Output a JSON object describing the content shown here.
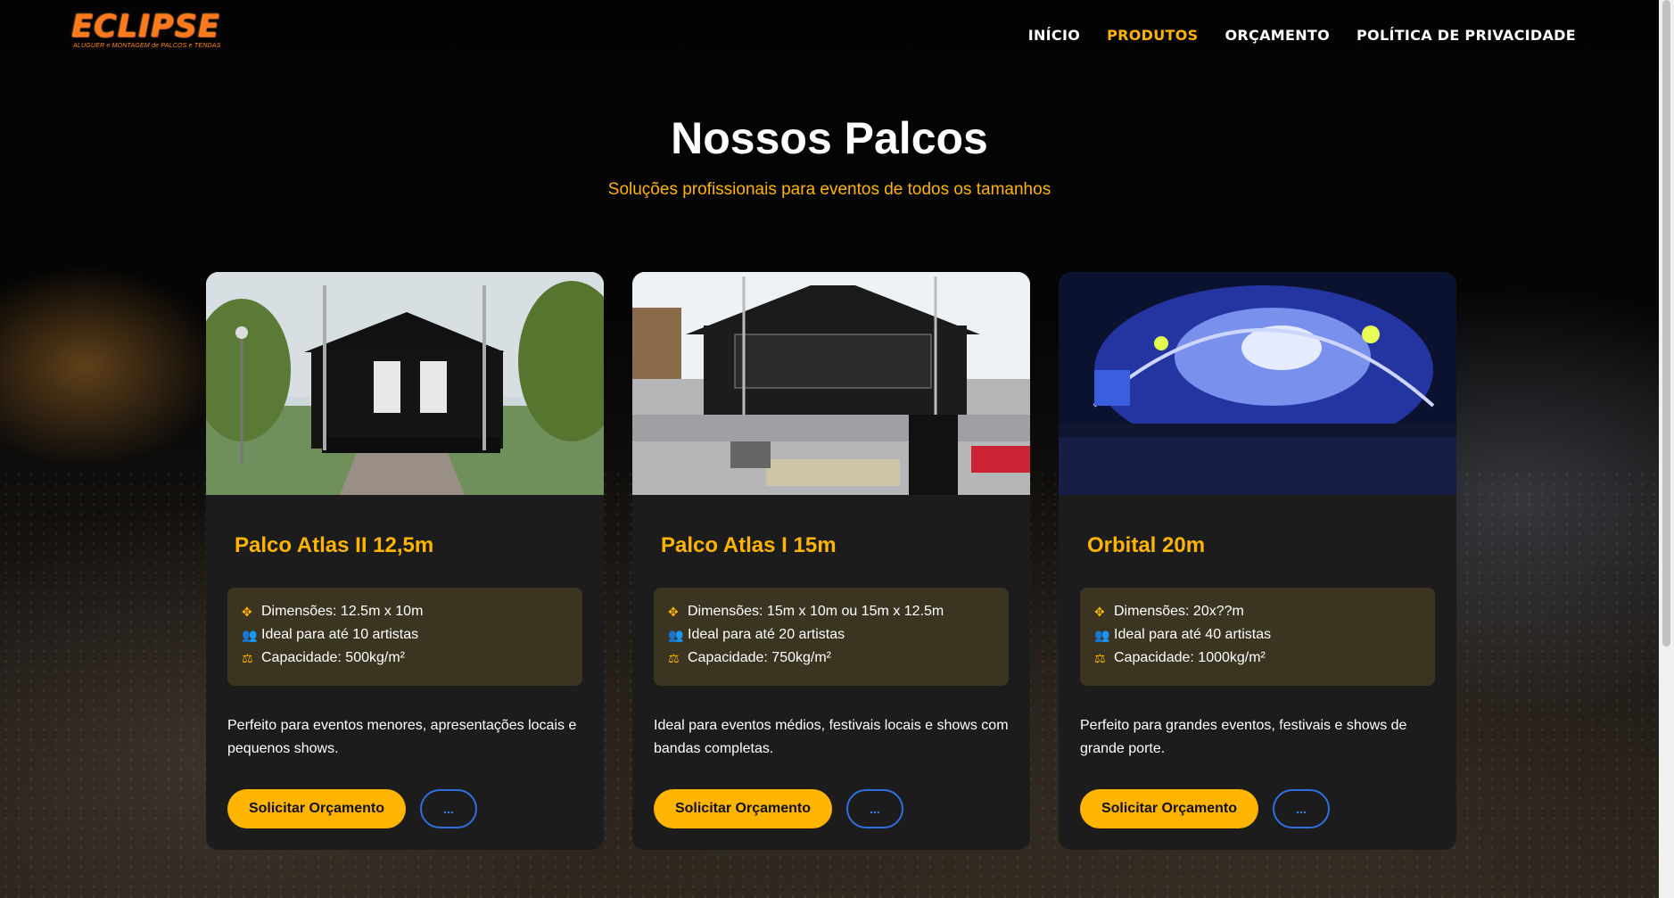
{
  "logo": {
    "name": "ECLIPSE",
    "tagline": "ALUGUER e MONTAGEM de PALCOS e TENDAS"
  },
  "nav": {
    "items": [
      "INÍCIO",
      "PRODUTOS",
      "ORÇAMENTO",
      "POLÍTICA DE PRIVACIDADE"
    ],
    "active": "PRODUTOS"
  },
  "hero": {
    "title": "Nossos Palcos",
    "subtitle": "Soluções profissionais para eventos de todos os tamanhos"
  },
  "cards": [
    {
      "title": "Palco Atlas II 12,5m",
      "specs": [
        "Dimensões: 12.5m x 10m",
        "Ideal para até 10 artistas",
        "Capacidade: 500kg/m²"
      ],
      "description": "Perfeito para eventos menores, apresentações locais e pequenos shows.",
      "cta": "Solicitar Orçamento",
      "more": "..."
    },
    {
      "title": "Palco Atlas I 15m",
      "specs": [
        "Dimensões: 15m x 10m ou 15m x 12.5m",
        "Ideal para até 20 artistas",
        "Capacidade: 750kg/m²"
      ],
      "description": "Ideal para eventos médios, festivais locais e shows com bandas completas.",
      "cta": "Solicitar Orçamento",
      "more": "..."
    },
    {
      "title": "Orbital 20m",
      "specs": [
        "Dimensões: 20x??m",
        "Ideal para até 40 artistas",
        "Capacidade: 1000kg/m²"
      ],
      "description": "Perfeito para grandes eventos, festivais e shows de grande porte.",
      "cta": "Solicitar Orçamento",
      "more": "..."
    }
  ],
  "icons": {
    "dimension": "arrows-move-icon",
    "artists": "users-icon",
    "capacity": "weight-icon"
  },
  "colors": {
    "accent": "#ffb400",
    "card_bg": "#1c1c1c",
    "specs_bg": "#3a3420",
    "link_blue": "#2f6fe0"
  }
}
